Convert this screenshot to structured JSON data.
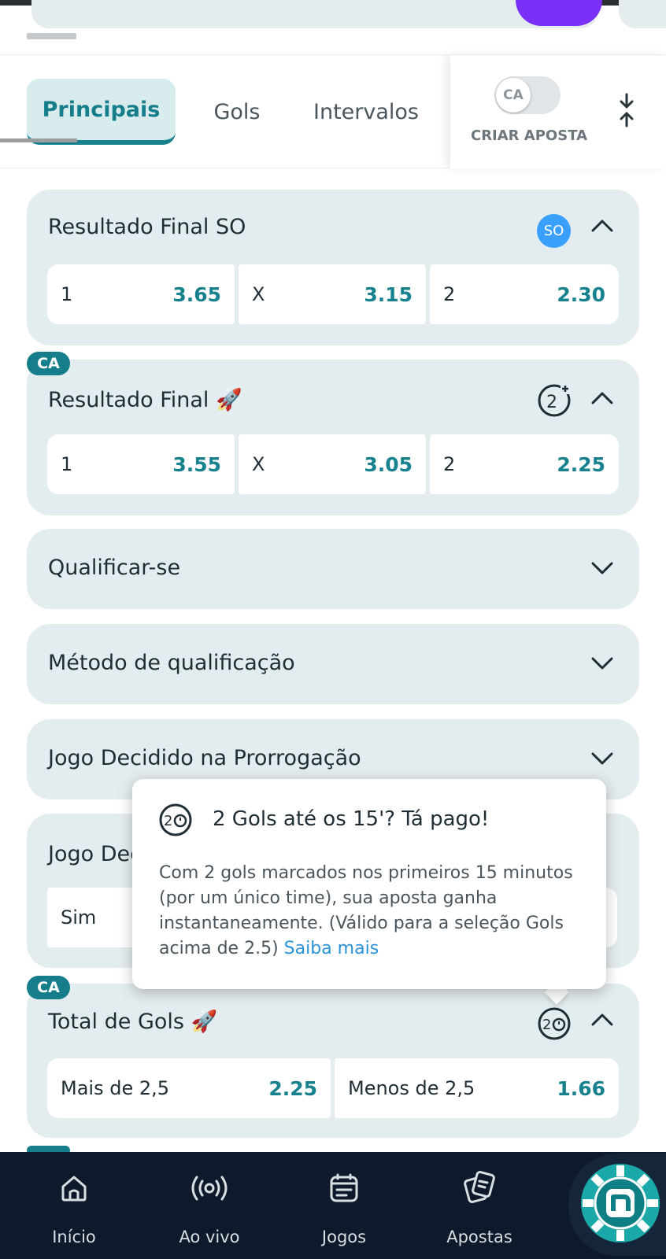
{
  "tabs": {
    "items": [
      {
        "label": "Principais"
      },
      {
        "label": "Gols"
      },
      {
        "label": "Intervalos"
      }
    ],
    "criar_aposta": {
      "toggle_label": "CA",
      "label": "CRIAR APOSTA"
    }
  },
  "markets": {
    "resultado_final_so": {
      "title": "Resultado Final SO",
      "badge": "SO",
      "odds": [
        {
          "label": "1",
          "value": "3.65"
        },
        {
          "label": "X",
          "value": "3.15"
        },
        {
          "label": "2",
          "value": "2.30"
        }
      ]
    },
    "resultado_final": {
      "ca_badge": "CA",
      "title": "Resultado Final 🚀",
      "odds": [
        {
          "label": "1",
          "value": "3.55"
        },
        {
          "label": "X",
          "value": "3.05"
        },
        {
          "label": "2",
          "value": "2.25"
        }
      ]
    },
    "qualificar": {
      "title": "Qualificar-se"
    },
    "metodo": {
      "title": "Método de qualificação"
    },
    "prorrogacao": {
      "title": "Jogo Decidido na Prorrogação"
    },
    "jogo_dec": {
      "title": "Jogo Dec",
      "option": "Sim"
    },
    "total_gols": {
      "ca_badge": "CA",
      "title": "Total de Gols 🚀",
      "odds": [
        {
          "label": "Mais de 2,5",
          "value": "2.25"
        },
        {
          "label": "Menos de 2,5",
          "value": "1.66"
        }
      ]
    }
  },
  "tooltip": {
    "title": "2 Gols até os 15'? Tá pago!",
    "body": "Com 2 gols marcados nos primeiros 15 minutos (por um único time), sua aposta ganha instantaneamente. (Válido para a seleção Gols acima de 2.5)",
    "link": "Saiba mais"
  },
  "bottom_nav": {
    "items": [
      {
        "label": "Início",
        "icon": "home-icon"
      },
      {
        "label": "Ao vivo",
        "icon": "live-icon"
      },
      {
        "label": "Jogos",
        "icon": "calendar-icon"
      },
      {
        "label": "Apostas",
        "icon": "bets-icon"
      }
    ],
    "brand_icon": "brand-chip-icon"
  },
  "colors": {
    "accent": "#17828e",
    "card_bg": "#e3ecee",
    "nav_bg": "#0e1a2b",
    "so_badge": "#3aa0ff",
    "link": "#2a93d8"
  }
}
